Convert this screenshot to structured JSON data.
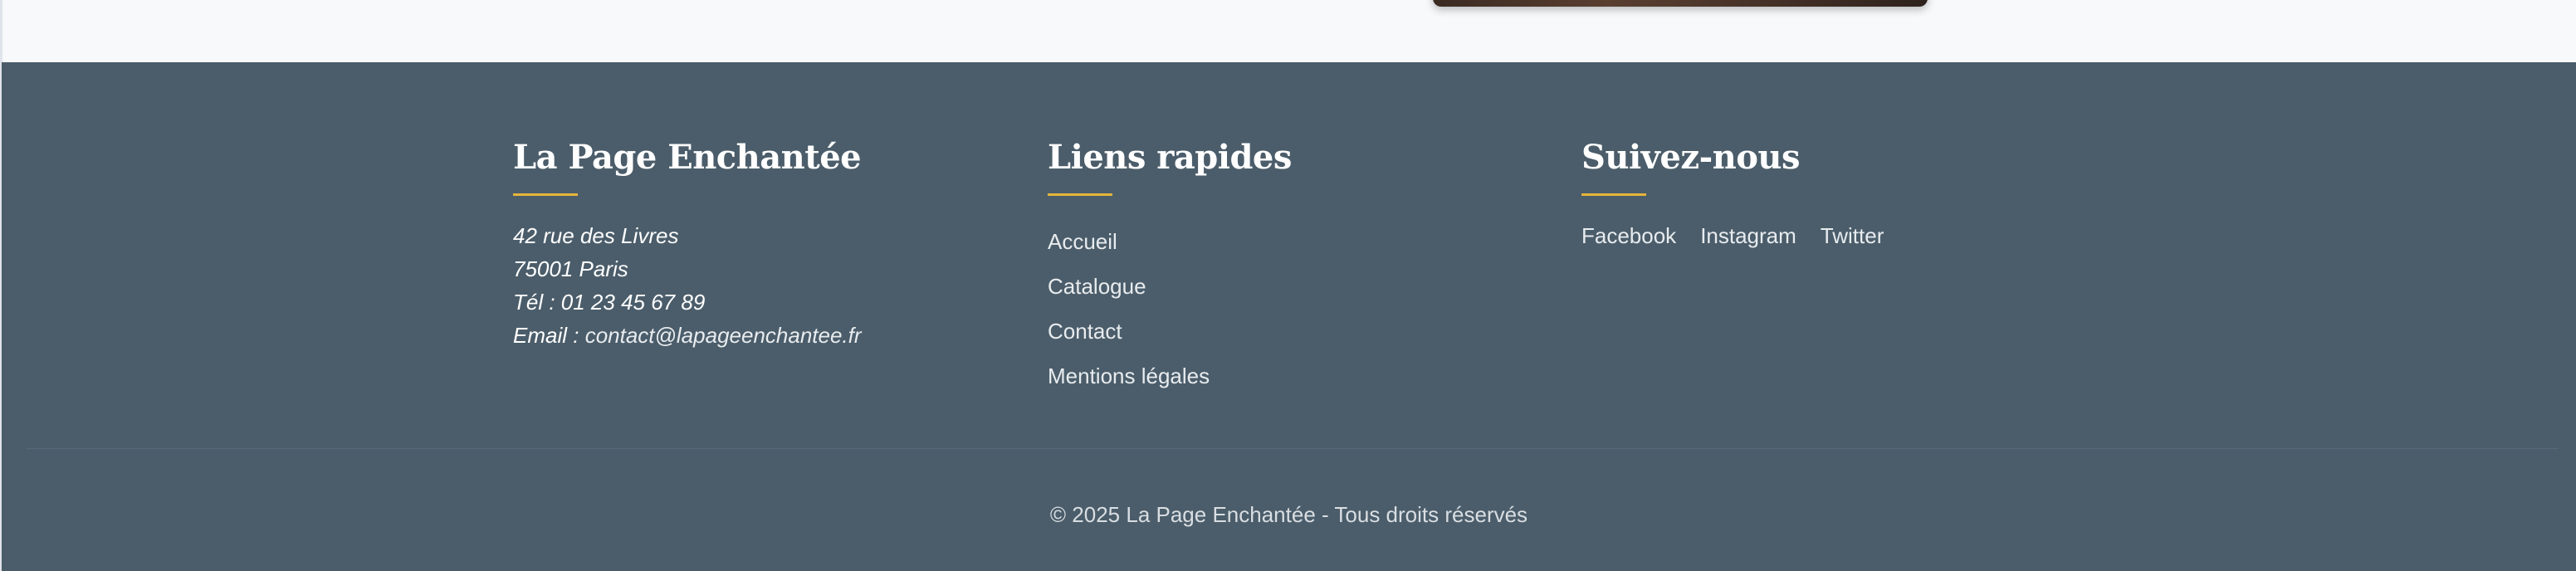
{
  "footer": {
    "contact": {
      "title": "La Page Enchantée",
      "address_line1": "42 rue des Livres",
      "address_line2": "75001 Paris",
      "phone": "Tél : 01 23 45 67 89",
      "email_label": "Email : ",
      "email": "contact@lapageenchantee.fr"
    },
    "quick_links": {
      "title": "Liens rapides",
      "items": [
        {
          "label": "Accueil"
        },
        {
          "label": "Catalogue"
        },
        {
          "label": "Contact"
        },
        {
          "label": "Mentions légales"
        }
      ]
    },
    "social": {
      "title": "Suivez-nous",
      "items": [
        {
          "label": "Facebook"
        },
        {
          "label": "Instagram"
        },
        {
          "label": "Twitter"
        }
      ]
    },
    "copyright": "© 2025 La Page Enchantée - Tous droits réservés"
  },
  "colors": {
    "footer_bg": "#4b5d6a",
    "accent": "#e6b53a",
    "page_bg": "#f7f9fb"
  }
}
